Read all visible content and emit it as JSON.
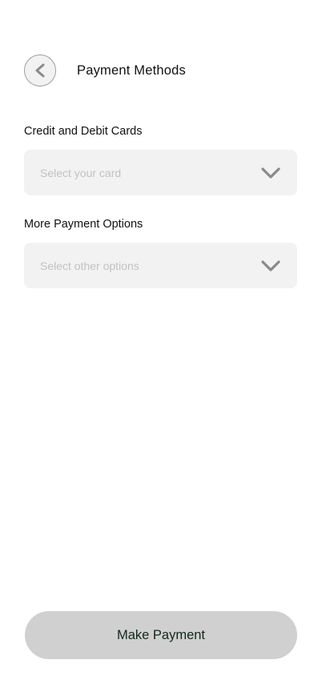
{
  "header": {
    "title": "Payment Methods",
    "back_icon": "chevron-left-icon"
  },
  "cards_section": {
    "label": "Credit and Debit Cards",
    "placeholder": "Select your card",
    "icon": "chevron-down-icon"
  },
  "other_section": {
    "label": "More Payment Options",
    "placeholder": "Select other options",
    "icon": "chevron-down-icon"
  },
  "footer": {
    "pay_label": "Make Payment"
  },
  "colors": {
    "field_bg": "#f2f2f2",
    "placeholder": "#c2c2c2",
    "button_bg": "#d0d0d0",
    "button_text": "#12281c",
    "icon": "#8a8a8a"
  }
}
